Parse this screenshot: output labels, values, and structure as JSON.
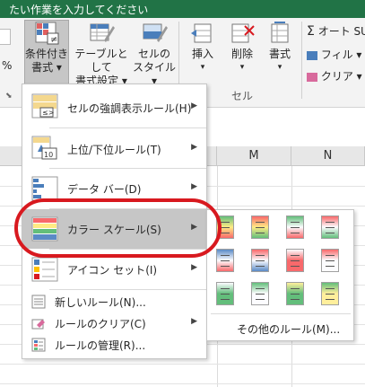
{
  "title_bar": {
    "text": "たい作業を入力してください"
  },
  "ribbon": {
    "conditional_format": {
      "line1": "条件付き",
      "line2": "書式 ▾"
    },
    "format_as_table": {
      "line1": "テーブルとして",
      "line2": "書式設定 ▾"
    },
    "cell_styles": {
      "line1": "セルの",
      "line2": "スタイル ▾"
    },
    "insert": {
      "label": "挿入"
    },
    "delete": {
      "label": "削除"
    },
    "format": {
      "label": "書式"
    },
    "cells_group": "セル",
    "autosum": "オート SU",
    "fill": "フィル ▾",
    "clear": "クリア ▾",
    "sigma": "Σ"
  },
  "columns": [
    "M",
    "N"
  ],
  "menu": {
    "items": [
      {
        "label": "セルの強調表示ルール(H)",
        "submenu": true
      },
      {
        "label": "上位/下位ルール(T)",
        "submenu": true
      },
      {
        "label": "データ バー(D)",
        "submenu": true
      },
      {
        "label": "カラー スケール(S)",
        "submenu": true,
        "highlighted": true
      },
      {
        "label": "アイコン セット(I)",
        "submenu": true
      }
    ],
    "small_items": [
      {
        "label": "新しいルール(N)..."
      },
      {
        "label": "ルールのクリア(C)",
        "submenu": true
      },
      {
        "label": "ルールの管理(R)..."
      }
    ]
  },
  "color_scale_submenu": {
    "swatches": [
      [
        "#63be7b",
        "#ffeb84",
        "#f8696b"
      ],
      [
        "#f8696b",
        "#ffeb84",
        "#63be7b"
      ],
      [
        "#63be7b",
        "#fcfcff",
        "#f8696b"
      ],
      [
        "#f8696b",
        "#fcfcff",
        "#63be7b"
      ],
      [
        "#5a8ac6",
        "#fcfcff",
        "#f8696b"
      ],
      [
        "#f8696b",
        "#fcfcff",
        "#5a8ac6"
      ],
      [
        "#fcfcff",
        "#f8696b",
        "#f8696b"
      ],
      [
        "#f8696b",
        "#fcfcff",
        "#fcfcff"
      ],
      [
        "#fcfcff",
        "#63be7b",
        "#63be7b"
      ],
      [
        "#63be7b",
        "#fcfcff",
        "#fcfcff"
      ],
      [
        "#ffef9c",
        "#63be7b",
        "#63be7b"
      ],
      [
        "#63be7b",
        "#ffef9c",
        "#ffef9c"
      ]
    ],
    "more_rules": "その他のルール(M)..."
  },
  "colors": {
    "title_bar": "#217346",
    "highlight": "#c6c6c6",
    "annotation": "#d8191f"
  }
}
